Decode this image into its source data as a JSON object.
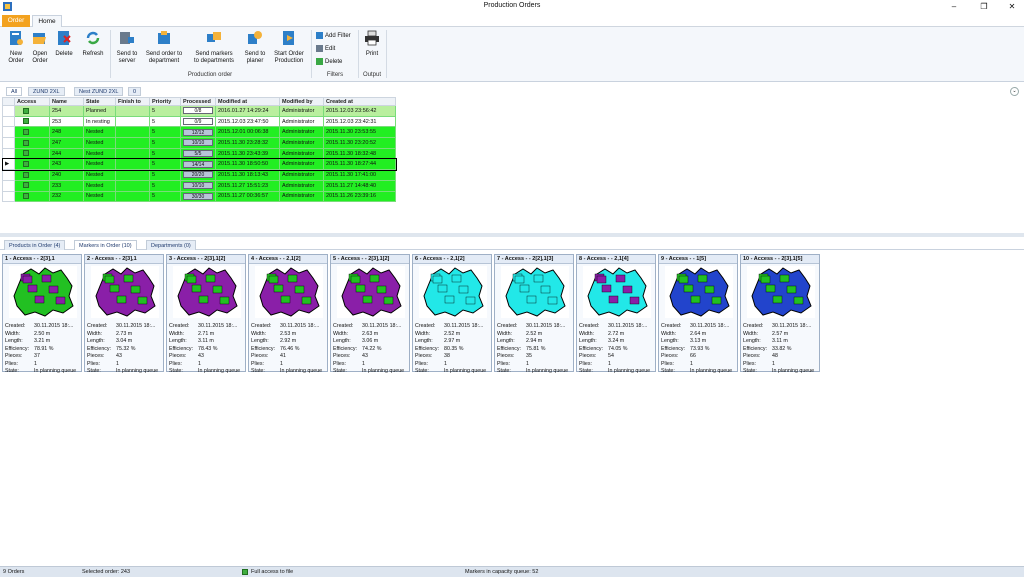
{
  "window": {
    "title": "Production Orders"
  },
  "ribbon_tabs": [
    "Order",
    "Home"
  ],
  "ribbon": {
    "buttons": [
      {
        "label1": "New",
        "label2": "Order",
        "icon": "new-order-icon"
      },
      {
        "label1": "Open",
        "label2": "Order",
        "icon": "open-order-icon"
      },
      {
        "label1": "Delete",
        "label2": "",
        "icon": "delete-icon"
      },
      {
        "label1": "Refresh",
        "label2": "",
        "icon": "refresh-icon"
      },
      {
        "label1": "Send to",
        "label2": "server",
        "icon": "send-server-icon"
      },
      {
        "label1": "Send order to",
        "label2": "department",
        "icon": "send-department-icon"
      },
      {
        "label1": "Send markers",
        "label2": "to departments",
        "icon": "send-markers-icon"
      },
      {
        "label1": "Send to",
        "label2": "planer",
        "icon": "send-planer-icon"
      },
      {
        "label1": "Start Order",
        "label2": "Production",
        "icon": "start-production-icon"
      },
      {
        "label1": "Print",
        "label2": "",
        "icon": "print-icon"
      }
    ],
    "filters": [
      "Add Filter",
      "Edit",
      "Delete"
    ],
    "groups": {
      "production": "Production order",
      "filters": "Filters",
      "output": "Output"
    }
  },
  "view_tabs": [
    "All",
    "ZUND 2XL",
    "Nest ZUND 2XL",
    "0"
  ],
  "grid": {
    "columns": [
      "Access",
      "Name",
      "State",
      "Finish to",
      "Priority",
      "Processed",
      "Modified at",
      "Modified by",
      "Created at"
    ],
    "rows": [
      {
        "name": "254",
        "state": "Planned",
        "finish": "",
        "priority": "5",
        "processed": "0/8",
        "done": 0,
        "modified": "2016.01.27 14:29:24",
        "by": "Administrator",
        "created": "2015.12.03 23:56:42",
        "color": "#b9ef9e"
      },
      {
        "name": "253",
        "state": "In nesting",
        "finish": "",
        "priority": "5",
        "processed": "0/9",
        "done": 0,
        "modified": "2015.12.03 23:47:50",
        "by": "Administrator",
        "created": "2015.12.03 23:42:31",
        "color": "#ffffff"
      },
      {
        "name": "248",
        "state": "Nested",
        "finish": "",
        "priority": "5",
        "processed": "12/12",
        "done": 1,
        "modified": "2015.12.01 00:06:38",
        "by": "Administrator",
        "created": "2015.11.30 23:53:55",
        "color": "#22ee22"
      },
      {
        "name": "247",
        "state": "Nested",
        "finish": "",
        "priority": "5",
        "processed": "10/10",
        "done": 1,
        "modified": "2015.11.30 23:28:32",
        "by": "Administrator",
        "created": "2015.11.30 23:20:52",
        "color": "#22ee22"
      },
      {
        "name": "244",
        "state": "Nested",
        "finish": "",
        "priority": "5",
        "processed": "5/5",
        "done": 1,
        "modified": "2015.11.30 23:43:39",
        "by": "Administrator",
        "created": "2015.11.30 18:32:48",
        "color": "#22ee22"
      },
      {
        "name": "243",
        "state": "Nested",
        "finish": "",
        "priority": "5",
        "processed": "14/14",
        "done": 1,
        "modified": "2015.11.30 18:50:50",
        "by": "Administrator",
        "created": "2015.11.30 18:27:44",
        "color": "#22ee22"
      },
      {
        "name": "240",
        "state": "Nested",
        "finish": "",
        "priority": "5",
        "processed": "20/20",
        "done": 1,
        "modified": "2015.11.30 18:13:43",
        "by": "Administrator",
        "created": "2015.11.30 17:41:00",
        "color": "#22ee22"
      },
      {
        "name": "233",
        "state": "Nested",
        "finish": "",
        "priority": "5",
        "processed": "10/10",
        "done": 1,
        "modified": "2015.11.27 15:51:23",
        "by": "Administrator",
        "created": "2015.11.27 14:48:40",
        "color": "#22ee22"
      },
      {
        "name": "232",
        "state": "Nested",
        "finish": "",
        "priority": "5",
        "processed": "30/30",
        "done": 1,
        "modified": "2015.11.27 00:36:57",
        "by": "Administrator",
        "created": "2015.11.26 23:39:16",
        "color": "#22ee22"
      }
    ]
  },
  "lower_tabs": [
    "Products in Order (4)",
    "Markers in Order (10)",
    "Departments (0)"
  ],
  "card_labels": [
    "Created:",
    "Width:",
    "Length:",
    "Efficiency:",
    "Pieces:",
    "Plies:",
    "State:"
  ],
  "markers": [
    {
      "title": "1 - Access - - 2[3],1",
      "created": "30.11.2015 18:...",
      "width": "2.50 m",
      "length": "3.21 m",
      "efficiency": "78.91 %",
      "pieces": "37",
      "plies": "1",
      "state": "In planning queue",
      "c1": "#22c022",
      "c2": "#8a1fa8"
    },
    {
      "title": "2 - Access - - 2[3],1",
      "created": "30.11.2015 18:...",
      "width": "2.73 m",
      "length": "3.04 m",
      "efficiency": "75.32 %",
      "pieces": "43",
      "plies": "1",
      "state": "In planning queue",
      "c1": "#8a1fa8",
      "c2": "#22c022"
    },
    {
      "title": "3 - Access - - 2[3],1[2]",
      "created": "30.11.2015 18:...",
      "width": "2.71 m",
      "length": "3.11 m",
      "efficiency": "78.43 %",
      "pieces": "43",
      "plies": "1",
      "state": "In planning queue",
      "c1": "#8a1fa8",
      "c2": "#22c022"
    },
    {
      "title": "4 - Access - - 2,1[2]",
      "created": "30.11.2015 18:...",
      "width": "2.53 m",
      "length": "2.92 m",
      "efficiency": "76.46 %",
      "pieces": "41",
      "plies": "1",
      "state": "In planning queue",
      "c1": "#8a1fa8",
      "c2": "#22c022"
    },
    {
      "title": "5 - Access - - 2[3],1[2]",
      "created": "30.11.2015 18:...",
      "width": "2.63 m",
      "length": "3.06 m",
      "efficiency": "74.22 %",
      "pieces": "43",
      "plies": "1",
      "state": "In planning queue",
      "c1": "#8a1fa8",
      "c2": "#22c022"
    },
    {
      "title": "6 - Access - - 2,1[2]",
      "created": "30.11.2015 18:...",
      "width": "2.52 m",
      "length": "2.97 m",
      "efficiency": "80.35 %",
      "pieces": "38",
      "plies": "1",
      "state": "In planning queue",
      "c1": "#22e8e8",
      "c2": "#22e8e8"
    },
    {
      "title": "7 - Access - - 2[2],1[3]",
      "created": "30.11.2015 18:...",
      "width": "2.52 m",
      "length": "2.94 m",
      "efficiency": "75.81 %",
      "pieces": "35",
      "plies": "1",
      "state": "In planning queue",
      "c1": "#22e8e8",
      "c2": "#22e8e8"
    },
    {
      "title": "8 - Access - - 2,1[4]",
      "created": "30.11.2015 18:...",
      "width": "2.72 m",
      "length": "3.24 m",
      "efficiency": "74.05 %",
      "pieces": "54",
      "plies": "1",
      "state": "In planning queue",
      "c1": "#22e8e8",
      "c2": "#8a1fa8"
    },
    {
      "title": "9 - Access - - 1[5]",
      "created": "30.11.2015 18:...",
      "width": "2.64 m",
      "length": "3.13 m",
      "efficiency": "73.93 %",
      "pieces": "66",
      "plies": "1",
      "state": "In planning queue",
      "c1": "#2244cc",
      "c2": "#22c022"
    },
    {
      "title": "10 - Access - - 2[3],1[5]",
      "created": "30.11.2015 18:...",
      "width": "2.57 m",
      "length": "3.11 m",
      "efficiency": "33.82 %",
      "pieces": "48",
      "plies": "1",
      "state": "In planning queue",
      "c1": "#2244cc",
      "c2": "#22c022"
    }
  ],
  "status": {
    "orders": "9 Orders",
    "selected": "Selected order: 243",
    "access": "Full access to file",
    "queue": "Markers in capacity queue: 52"
  }
}
